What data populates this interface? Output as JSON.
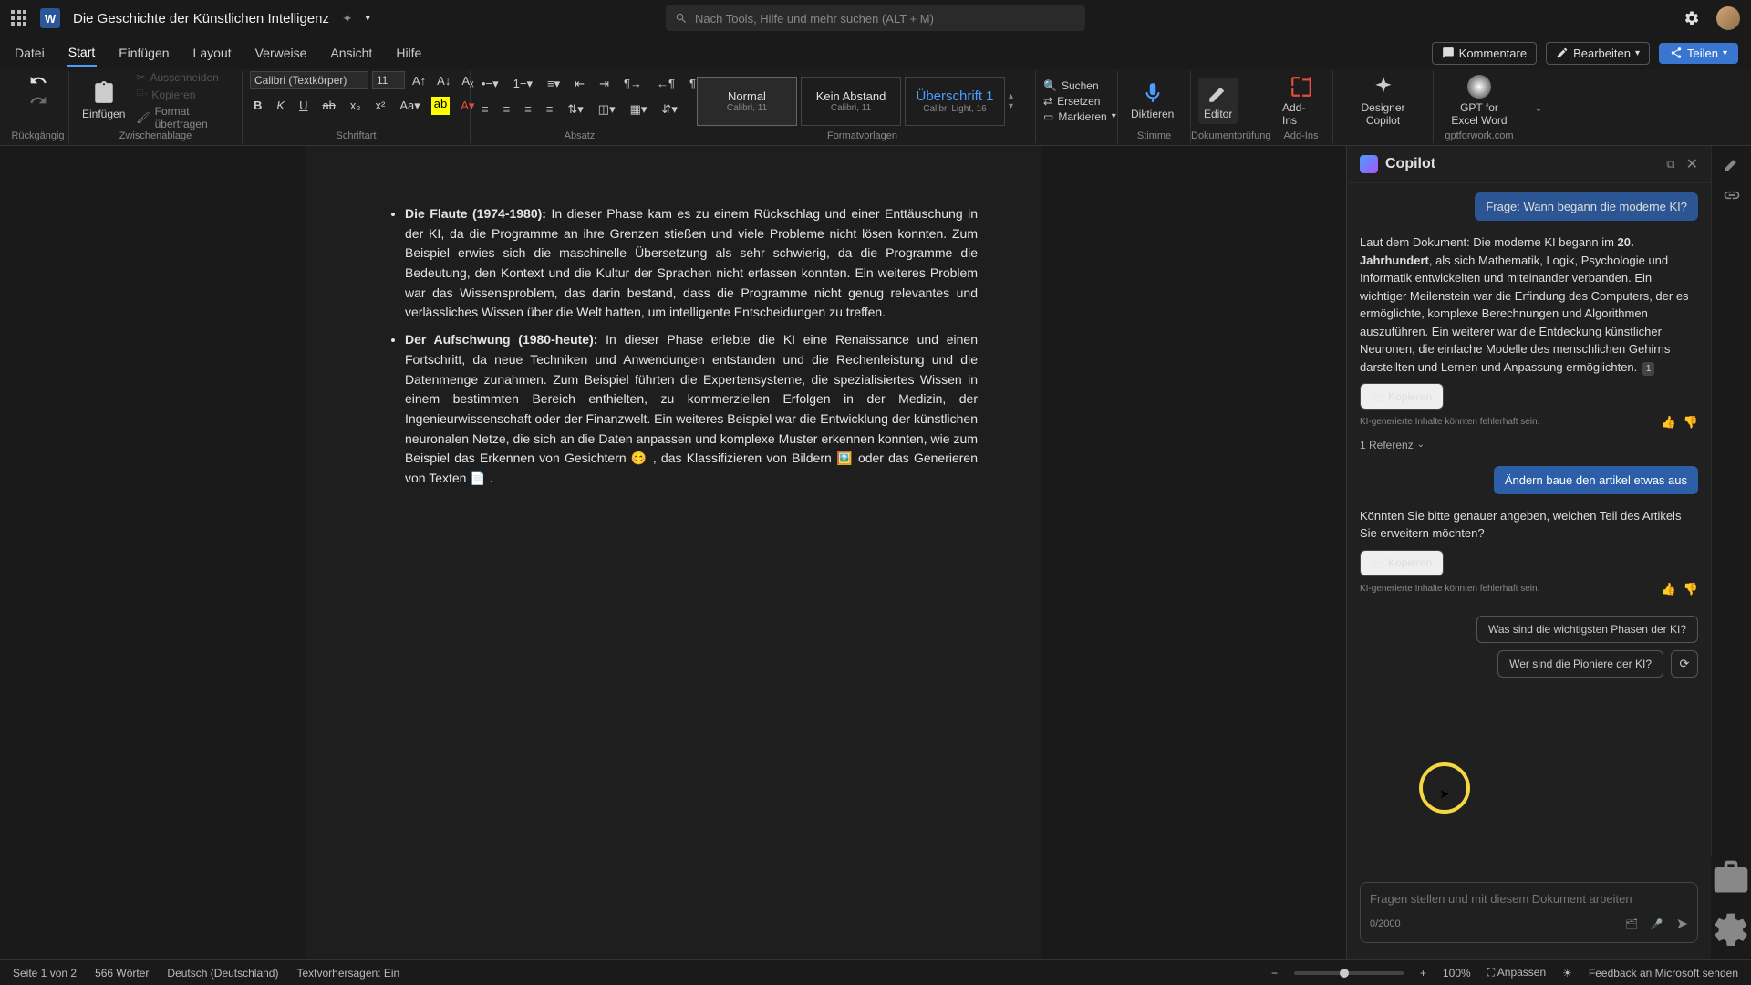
{
  "titlebar": {
    "doc_title": "Die Geschichte der Künstlichen Intelligenz",
    "search_placeholder": "Nach Tools, Hilfe und mehr suchen (ALT + M)"
  },
  "menubar": {
    "tabs": [
      "Datei",
      "Start",
      "Einfügen",
      "Layout",
      "Verweise",
      "Ansicht",
      "Hilfe"
    ],
    "active_index": 1,
    "comments": "Kommentare",
    "edit": "Bearbeiten",
    "share": "Teilen"
  },
  "ribbon": {
    "undo_group": "Rückgängig",
    "paste": "Einfügen",
    "cut": "Ausschneiden",
    "copy": "Kopieren",
    "format_painter": "Format übertragen",
    "clipboard_group": "Zwischenablage",
    "font_name": "Calibri (Textkörper)",
    "font_size": "11",
    "font_group": "Schriftart",
    "para_group": "Absatz",
    "styles": [
      {
        "name": "Normal",
        "sub": "Calibri, 11"
      },
      {
        "name": "Kein Abstand",
        "sub": "Calibri, 11"
      },
      {
        "name": "Überschrift 1",
        "sub": "Calibri Light, 16"
      }
    ],
    "styles_group": "Formatvorlagen",
    "find": "Suchen",
    "replace": "Ersetzen",
    "select": "Markieren",
    "dictate": "Diktieren",
    "voice_group": "Stimme",
    "editor": "Editor",
    "editor_group": "Dokumentprüfung",
    "addins": "Add-Ins",
    "addins_group": "Add-Ins",
    "designer": "Designer Copilot",
    "gpt": "GPT for Excel Word",
    "gpt_group": "gptforwork.com"
  },
  "document": {
    "para1_b": "Die Flaute (1974-1980):",
    "para1": " In dieser Phase kam es zu einem Rückschlag und einer Enttäuschung in der KI, da die Programme an ihre Grenzen stießen und viele Probleme nicht lösen konnten. Zum Beispiel erwies sich die maschinelle Übersetzung als sehr schwierig, da die Programme die Bedeutung, den Kontext und die Kultur der Sprachen nicht erfassen konnten. Ein weiteres Problem war das Wissensproblem, das darin bestand, dass die Programme nicht genug relevantes und verlässliches Wissen über die Welt hatten, um intelligente Entscheidungen zu treffen.",
    "para2_b": "Der Aufschwung (1980-heute):",
    "para2": " In dieser Phase erlebte die KI eine Renaissance und einen Fortschritt, da neue Techniken und Anwendungen entstanden und die Rechenleistung und die Datenmenge zunahmen. Zum Beispiel führten die Expertensysteme, die spezialisiertes Wissen in einem bestimmten Bereich enthielten, zu kommerziellen Erfolgen in der Medizin, der Ingenieurwissenschaft oder der Finanzwelt. Ein weiteres Beispiel war die Entwicklung der künstlichen neuronalen Netze, die sich an die Daten anpassen und komplexe Muster erkennen konnten, wie zum Beispiel das Erkennen von Gesichtern 😊 , das Klassifizieren von Bildern 🖼️ oder das Generieren von Texten 📄 ."
  },
  "copilot": {
    "title": "Copilot",
    "prev_prompt": "Frage: Wann begann die moderne KI?",
    "answer_pre": "Laut dem Dokument: Die moderne KI begann im ",
    "answer_bold": "20. Jahrhundert",
    "answer_post": ", als sich Mathematik, Logik, Psychologie und Informatik entwickelten und miteinander verbanden. Ein wichtiger Meilenstein war die Erfindung des Computers, der es ermöglichte, komplexe Berechnungen und Algorithmen auszuführen. Ein weiterer war die Entdeckung künstlicher Neuronen, die einfache Modelle des menschlichen Gehirns darstellten und Lernen und Anpassung ermöglichten.",
    "citation": "1",
    "copy_label": "Kopieren",
    "disclaimer": "KI-generierte Inhalte könnten fehlerhaft sein.",
    "reference": "1 Referenz",
    "user_msg2": "Ändern baue den artikel etwas aus",
    "answer2": "Könnten Sie bitte genauer angeben, welchen Teil des Artikels Sie erweitern möchten?",
    "suggestion1": "Was sind die wichtigsten Phasen der KI?",
    "suggestion2": "Wer sind die Pioniere der KI?",
    "input_placeholder": "Fragen stellen und mit diesem Dokument arbeiten",
    "counter": "0/2000"
  },
  "statusbar": {
    "page": "Seite 1 von 2",
    "words": "566 Wörter",
    "lang": "Deutsch (Deutschland)",
    "predict": "Textvorhersagen: Ein",
    "zoom": "100%",
    "fit": "Anpassen",
    "feedback": "Feedback an Microsoft senden"
  }
}
